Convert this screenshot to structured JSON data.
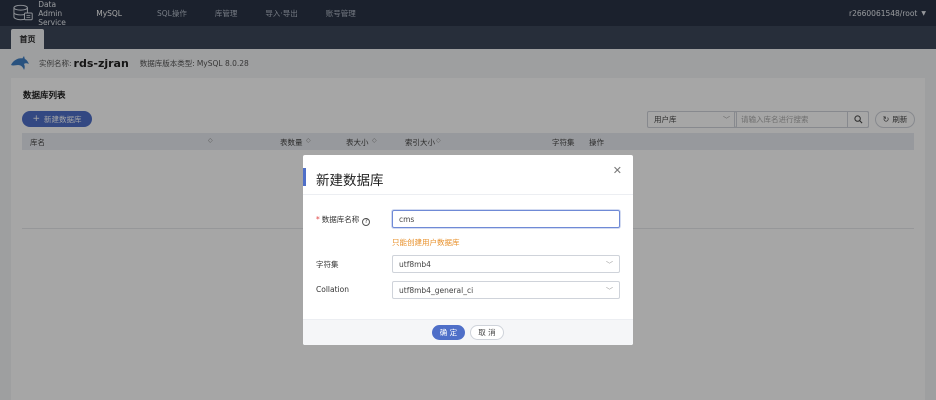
{
  "topbar": {
    "logo_line1": "Data",
    "logo_line2": "Admin Service",
    "logo_product": "MySQL",
    "nav": [
      "SQL操作",
      "库管理",
      "导入·导出",
      "账号管理"
    ],
    "user": "r2660061548/root"
  },
  "tabs": {
    "home": "首页"
  },
  "instance": {
    "label": "实例名称:",
    "name": "rds-zjran",
    "version_label": "数据库版本类型:",
    "version": "MySQL 8.0.28"
  },
  "main": {
    "title": "数据库列表",
    "new_button": "新建数据库",
    "user_db_select": "用户库",
    "search_placeholder": "请输入库名进行搜索",
    "refresh": "刷新",
    "columns": [
      "库名",
      "表数量",
      "表大小",
      "索引大小",
      "字符集",
      "操作"
    ]
  },
  "modal": {
    "title": "新建数据库",
    "name_label": "数据库名称",
    "name_value": "cms",
    "name_hint": "只能创建用户数据库",
    "charset_label": "字符集",
    "charset_value": "utf8mb4",
    "collation_label": "Collation",
    "collation_value": "utf8mb4_general_ci",
    "ok": "确 定",
    "cancel": "取 消"
  },
  "colors": {
    "accent": "#4f6fc8",
    "topbar": "#2a3445",
    "hint": "#e8902a"
  }
}
